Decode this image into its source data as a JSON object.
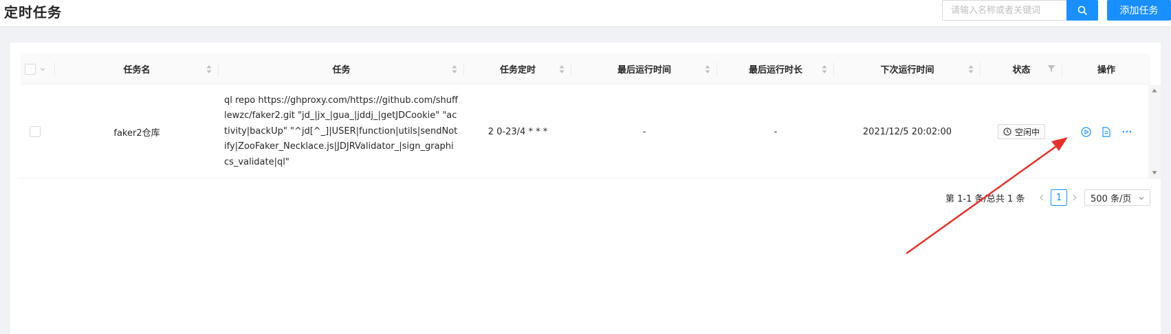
{
  "header": {
    "title": "定时任务",
    "search_placeholder": "请输入名称或者关键词",
    "add_button": "添加任务"
  },
  "table": {
    "columns": [
      {
        "key": "select",
        "label": ""
      },
      {
        "key": "name",
        "label": "任务名"
      },
      {
        "key": "command",
        "label": "任务"
      },
      {
        "key": "schedule",
        "label": "任务定时"
      },
      {
        "key": "last_run",
        "label": "最后运行时间"
      },
      {
        "key": "last_duration",
        "label": "最后运行时长"
      },
      {
        "key": "next_run",
        "label": "下次运行时间"
      },
      {
        "key": "status",
        "label": "状态"
      },
      {
        "key": "actions",
        "label": "操作"
      }
    ],
    "rows": [
      {
        "name": "faker2仓库",
        "command": "ql repo https://ghproxy.com/https://github.com/shufflewzc/faker2.git \"jd_|jx_|gua_|jddj_|getJDCookie\" \"activity|backUp\" \"^jd[^_]|USER|function|utils|sendNotify|ZooFaker_Necklace.js|JDJRValidator_|sign_graphics_validate|ql\"",
        "schedule": "2 0-23/4 * * *",
        "last_run": "-",
        "last_duration": "-",
        "next_run": "2021/12/5 20:02:00",
        "status": "空闲中"
      }
    ]
  },
  "pagination": {
    "total_text": "第 1-1 条/总共 1 条",
    "current_page": "1",
    "page_size": "500 条/页"
  },
  "colors": {
    "accent": "#1890ff",
    "annotation_arrow": "#e8302a"
  },
  "icons": {
    "search": "search-icon",
    "run": "play-circle-icon",
    "log": "file-text-icon",
    "more": "ellipsis-icon",
    "status": "clock-icon"
  }
}
